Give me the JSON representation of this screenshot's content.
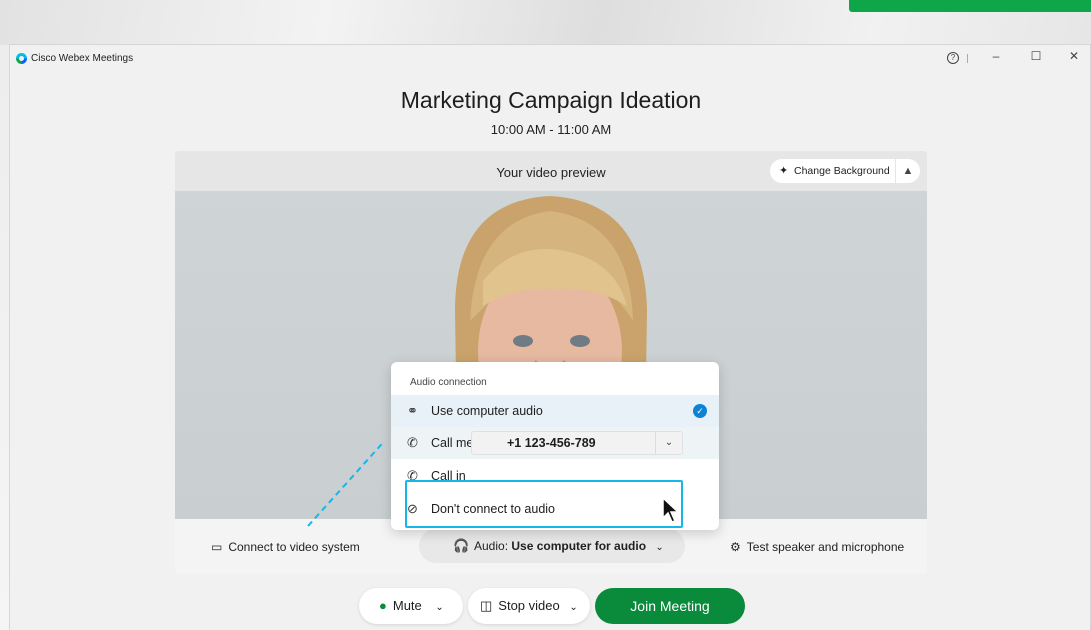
{
  "window": {
    "app_title": "Cisco Webex Meetings"
  },
  "meeting": {
    "title": "Marketing Campaign Ideation",
    "time": "10:00 AM - 11:00 AM"
  },
  "preview": {
    "label": "Your video preview",
    "change_background": "Change Background"
  },
  "audio_menu": {
    "header": "Audio connection",
    "items": [
      {
        "label": "Use computer audio",
        "icon": "headset-icon",
        "selected": true
      },
      {
        "label": "Call me at",
        "icon": "phone-callback-icon",
        "phone": "+1 123-456-789"
      },
      {
        "label": "Call in",
        "icon": "phone-call-icon"
      },
      {
        "label": "Don't connect to audio",
        "icon": "no-audio-icon"
      }
    ]
  },
  "footer": {
    "connect_video": "Connect to video system",
    "audio_prefix": "Audio: ",
    "audio_value": "Use computer for audio",
    "test_speaker": "Test speaker and microphone"
  },
  "controls": {
    "mute": "Mute",
    "stop_video": "Stop video",
    "join": "Join Meeting"
  },
  "colors": {
    "accent_green": "#0a8a3b",
    "highlight_blue": "#17b6e8",
    "check_blue": "#0d83d6"
  }
}
